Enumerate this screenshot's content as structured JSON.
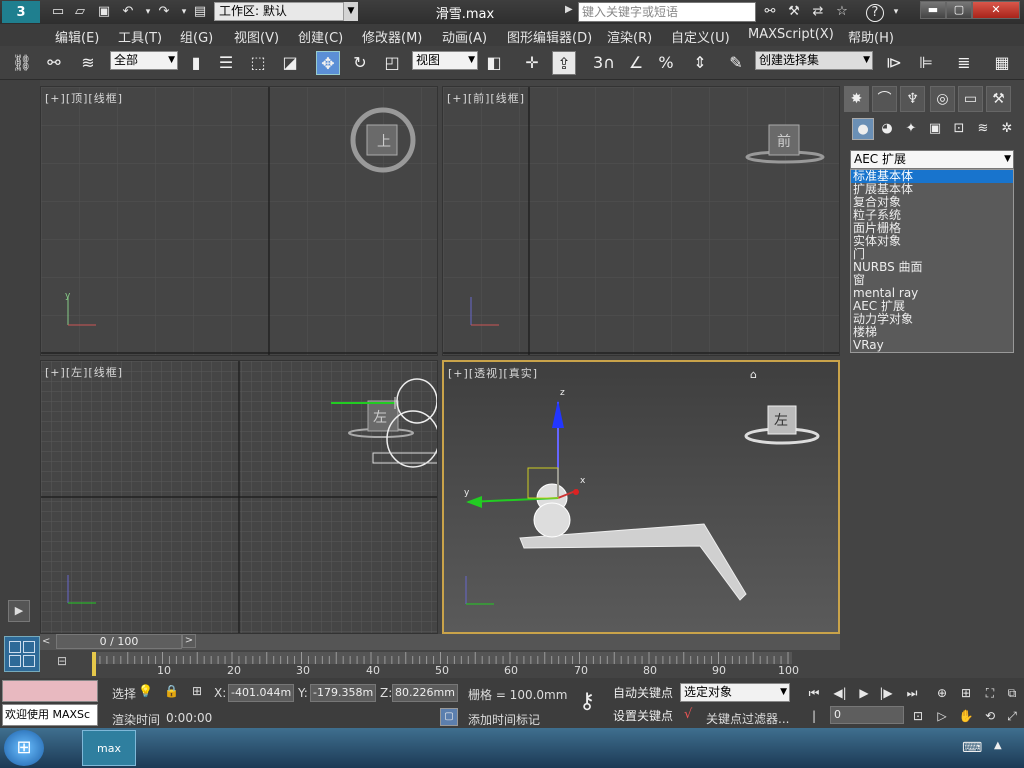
{
  "titlebar": {
    "workspace_label": "工作区: 默认",
    "file_title": "滑雪.max",
    "search_placeholder": "键入关键字或短语",
    "icons": [
      "new-icon",
      "open-icon",
      "save-icon",
      "undo-icon",
      "redo-icon",
      "project-icon"
    ]
  },
  "menu": [
    "编辑(E)",
    "工具(T)",
    "组(G)",
    "视图(V)",
    "创建(C)",
    "修改器(M)",
    "动画(A)",
    "图形编辑器(D)",
    "渲染(R)",
    "自定义(U)",
    "MAXScript(X)",
    "帮助(H)"
  ],
  "toolbar": {
    "filter_value": "全部",
    "refcoord_value": "视图",
    "selection_set_value": "创建选择集",
    "snap_value": "3"
  },
  "viewports": {
    "top": {
      "plus": "[+]",
      "name": "[顶]",
      "mode": "[线框]",
      "cube_label": "上"
    },
    "front": {
      "plus": "[+]",
      "name": "[前]",
      "mode": "[线框]",
      "cube_label": "前"
    },
    "left": {
      "plus": "[+]",
      "name": "[左]",
      "mode": "[线框]",
      "cube_label": "左"
    },
    "persp": {
      "plus": "[+]",
      "name": "[透视]",
      "mode": "[真实]",
      "cube_label": "左"
    }
  },
  "command_panel": {
    "category_selected": "AEC 扩展",
    "categories": [
      "标准基本体",
      "扩展基本体",
      "复合对象",
      "粒子系统",
      "面片栅格",
      "实体对象",
      "门",
      "NURBS 曲面",
      "窗",
      "mental ray",
      "AEC 扩展",
      "动力学对象",
      "楼梯",
      "VRay"
    ],
    "highlighted": "标准基本体"
  },
  "timeline": {
    "frame_display": "0 / 100",
    "ticks": [
      "10",
      "20",
      "30",
      "40",
      "50",
      "60",
      "70",
      "80",
      "90",
      "100"
    ]
  },
  "status": {
    "welcome": "欢迎使用 MAXSc",
    "select_label": "选择",
    "x_label": "X:",
    "x_value": "-401.044m",
    "y_label": "Y:",
    "y_value": "-179.358m",
    "z_label": "Z:",
    "z_value": "80.226mm",
    "grid_label": "栅格 = 100.0mm",
    "render_time_label": "渲染时间",
    "render_time_value": "0:00:00",
    "add_time_tag": "添加时间标记",
    "auto_key": "自动关键点",
    "set_key": "设置关键点",
    "selected_object": "选定对象",
    "key_filters": "关键点过滤器...",
    "frame_value": "0"
  }
}
